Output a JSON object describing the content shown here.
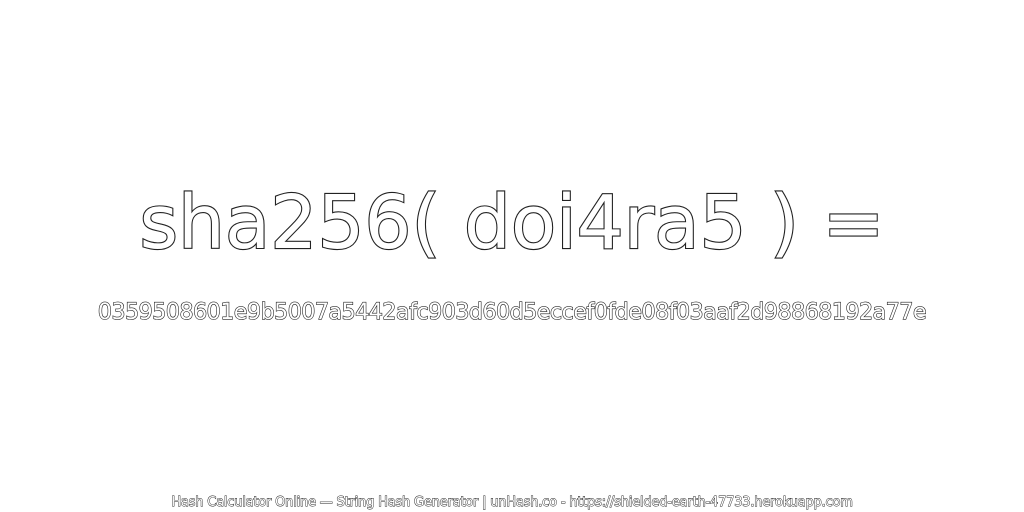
{
  "heading": {
    "expression": "sha256( doi4ra5 ) ="
  },
  "result": {
    "hash": "0359508601e9b5007a5442afc903d60d5eccef0fde08f03aaf2d98868192a77e"
  },
  "footer": {
    "text": "Hash Calculator Online — String Hash Generator | unHash.co - https://shielded-earth-47733.herokuapp.com"
  },
  "colors": {
    "background": "#ffffff",
    "text_fill": "#ffffff",
    "text_outline": "#222222"
  }
}
